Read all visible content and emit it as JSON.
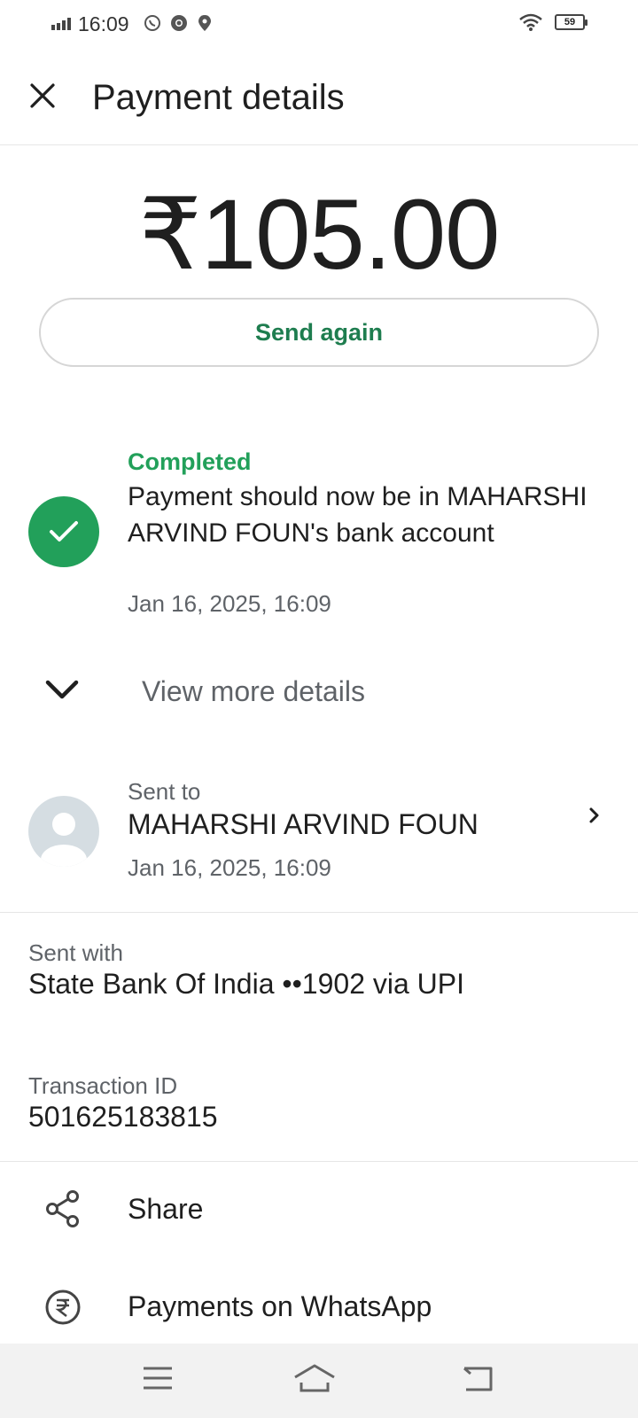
{
  "status_bar": {
    "time": "16:09",
    "battery": "59"
  },
  "app_bar": {
    "title": "Payment details"
  },
  "amount": "₹105.00",
  "send_again_label": "Send again",
  "payment_status": {
    "label": "Completed",
    "message": "Payment should now be in MAHARSHI ARVIND FOUN's bank account",
    "datetime": "Jan 16, 2025, 16:09"
  },
  "view_more_label": "View more details",
  "sent_to": {
    "label": "Sent to",
    "name": "MAHARSHI ARVIND FOUN",
    "datetime": "Jan 16, 2025, 16:09"
  },
  "sent_with": {
    "label": "Sent with",
    "value": "State Bank Of India ••1902 via UPI"
  },
  "transaction": {
    "label": "Transaction ID",
    "value": "501625183815"
  },
  "actions": [
    {
      "label": "Share",
      "icon": "share-icon"
    },
    {
      "label": "Payments on WhatsApp",
      "icon": "rupee-circle-icon"
    }
  ],
  "colors": {
    "accent_green": "#22a05a",
    "button_text_green": "#1e7d4f"
  }
}
